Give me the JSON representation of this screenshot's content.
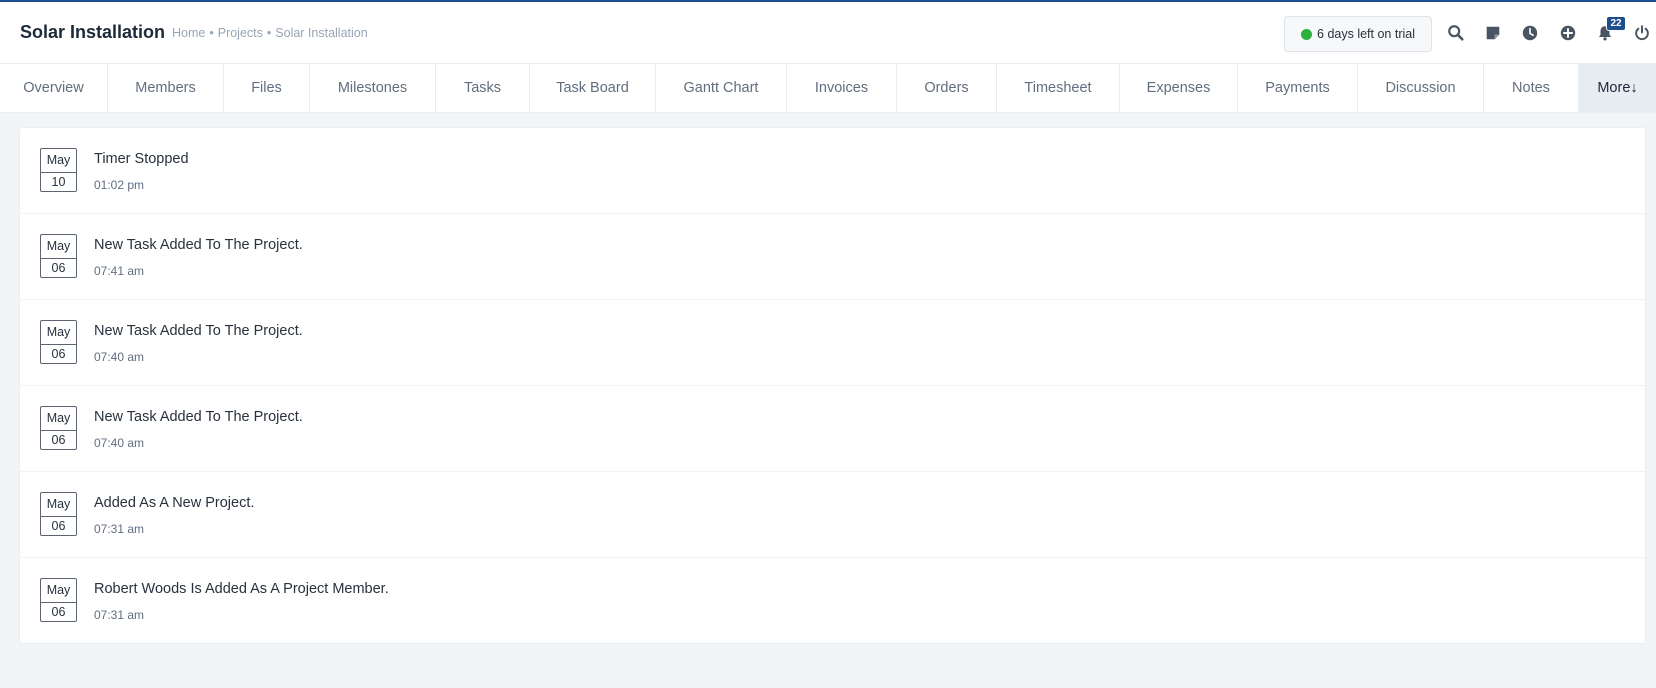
{
  "header": {
    "title": "Solar Installation",
    "breadcrumb": [
      "Home",
      "Projects",
      "Solar Installation"
    ],
    "breadcrumb_separator": "•",
    "trial_text": "6 days left on trial",
    "trial_dot_color": "#2cb040",
    "notification_count": "22",
    "icons": [
      "search-icon",
      "sticky-note-icon",
      "clock-icon",
      "add-circle-icon",
      "bell-icon",
      "power-icon"
    ]
  },
  "tabs": [
    {
      "label": "Overview"
    },
    {
      "label": "Members"
    },
    {
      "label": "Files"
    },
    {
      "label": "Milestones"
    },
    {
      "label": "Tasks"
    },
    {
      "label": "Task Board"
    },
    {
      "label": "Gantt Chart"
    },
    {
      "label": "Invoices"
    },
    {
      "label": "Orders"
    },
    {
      "label": "Timesheet"
    },
    {
      "label": "Expenses"
    },
    {
      "label": "Payments"
    },
    {
      "label": "Discussion"
    },
    {
      "label": "Notes"
    },
    {
      "label": "More↓",
      "active": true
    }
  ],
  "activities": [
    {
      "month": "May",
      "day": "10",
      "text": "Timer Stopped",
      "time": "01:02 pm"
    },
    {
      "month": "May",
      "day": "06",
      "text": "New Task Added To The Project.",
      "time": "07:41 am"
    },
    {
      "month": "May",
      "day": "06",
      "text": "New Task Added To The Project.",
      "time": "07:40 am"
    },
    {
      "month": "May",
      "day": "06",
      "text": "New Task Added To The Project.",
      "time": "07:40 am"
    },
    {
      "month": "May",
      "day": "06",
      "text": "Added As A New Project.",
      "time": "07:31 am"
    },
    {
      "month": "May",
      "day": "06",
      "text": "Robert Woods Is Added As A Project Member.",
      "time": "07:31 am"
    }
  ],
  "colors": {
    "brand": "#1d4d8e",
    "background": "#f2f4f7",
    "text": "#28313c",
    "muted": "#616e80"
  }
}
